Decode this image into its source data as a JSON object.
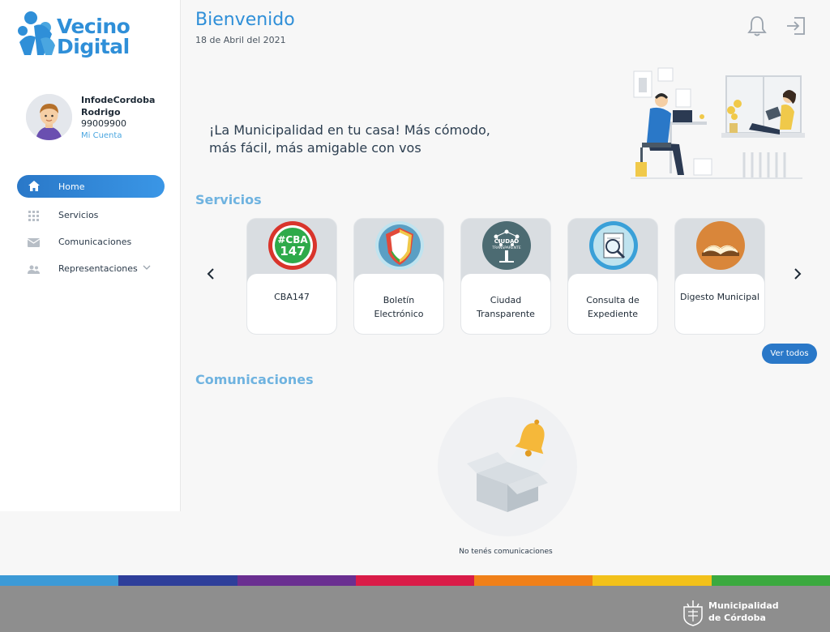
{
  "brand": {
    "line1": "Vecino",
    "line2": "Digital",
    "color": "#2f8fd8"
  },
  "user": {
    "name": "InfodeCordoba Rodrigo",
    "id": "99009900",
    "account_link": "Mi Cuenta"
  },
  "menu": {
    "items": [
      {
        "label": "Home",
        "icon": "home-icon",
        "active": true
      },
      {
        "label": "Servicios",
        "icon": "grid-icon",
        "active": false
      },
      {
        "label": "Comunicaciones",
        "icon": "mail-icon",
        "active": false
      },
      {
        "label": "Representaciones",
        "icon": "people-icon",
        "active": false
      }
    ]
  },
  "header": {
    "title": "Bienvenido",
    "date": "18 de Abril del 2021",
    "icons": [
      "bell-icon",
      "logout-icon"
    ]
  },
  "banner": {
    "text": "¡La Municipalidad en tu casa! Más cómodo, más fácil, más amigable con vos"
  },
  "services": {
    "title": "Servicios",
    "items": [
      {
        "label": "CBA147",
        "icon": "cba147-icon",
        "icon_text": "#CBA\n147"
      },
      {
        "label": "Boletín Electrónico",
        "icon": "shield-icon"
      },
      {
        "label": "Ciudad Transparente",
        "icon": "network-tree-icon",
        "icon_text": "CIUDAD TRANSPARENTE"
      },
      {
        "label": "Consulta de Expediente",
        "icon": "magnifier-document-icon"
      },
      {
        "label": "Digesto Municipal",
        "icon": "open-book-icon"
      }
    ],
    "view_all": "Ver todos"
  },
  "communications": {
    "title": "Comunicaciones",
    "empty_text": "No tenés comunicaciones"
  },
  "footer": {
    "logo_line1": "Municipalidad",
    "logo_line2": "de Córdoba",
    "stripe_colors": [
      "#3c9ad6",
      "#2e3f9a",
      "#6a2f91",
      "#d91c48",
      "#f08019",
      "#f2c11a",
      "#3ba93f"
    ]
  },
  "colors": {
    "accent": "#2a78c8",
    "section_title": "#6fb3e0"
  }
}
